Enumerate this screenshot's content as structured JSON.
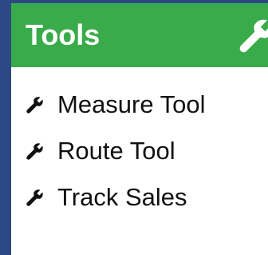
{
  "panel": {
    "title": "Tools",
    "title_icon": "wrench-icon",
    "header_color": "#3aab4a",
    "items": [
      {
        "label": "Measure Tool",
        "icon": "wrench-icon"
      },
      {
        "label": "Route Tool",
        "icon": "wrench-icon"
      },
      {
        "label": "Track Sales",
        "icon": "wrench-icon"
      }
    ]
  }
}
